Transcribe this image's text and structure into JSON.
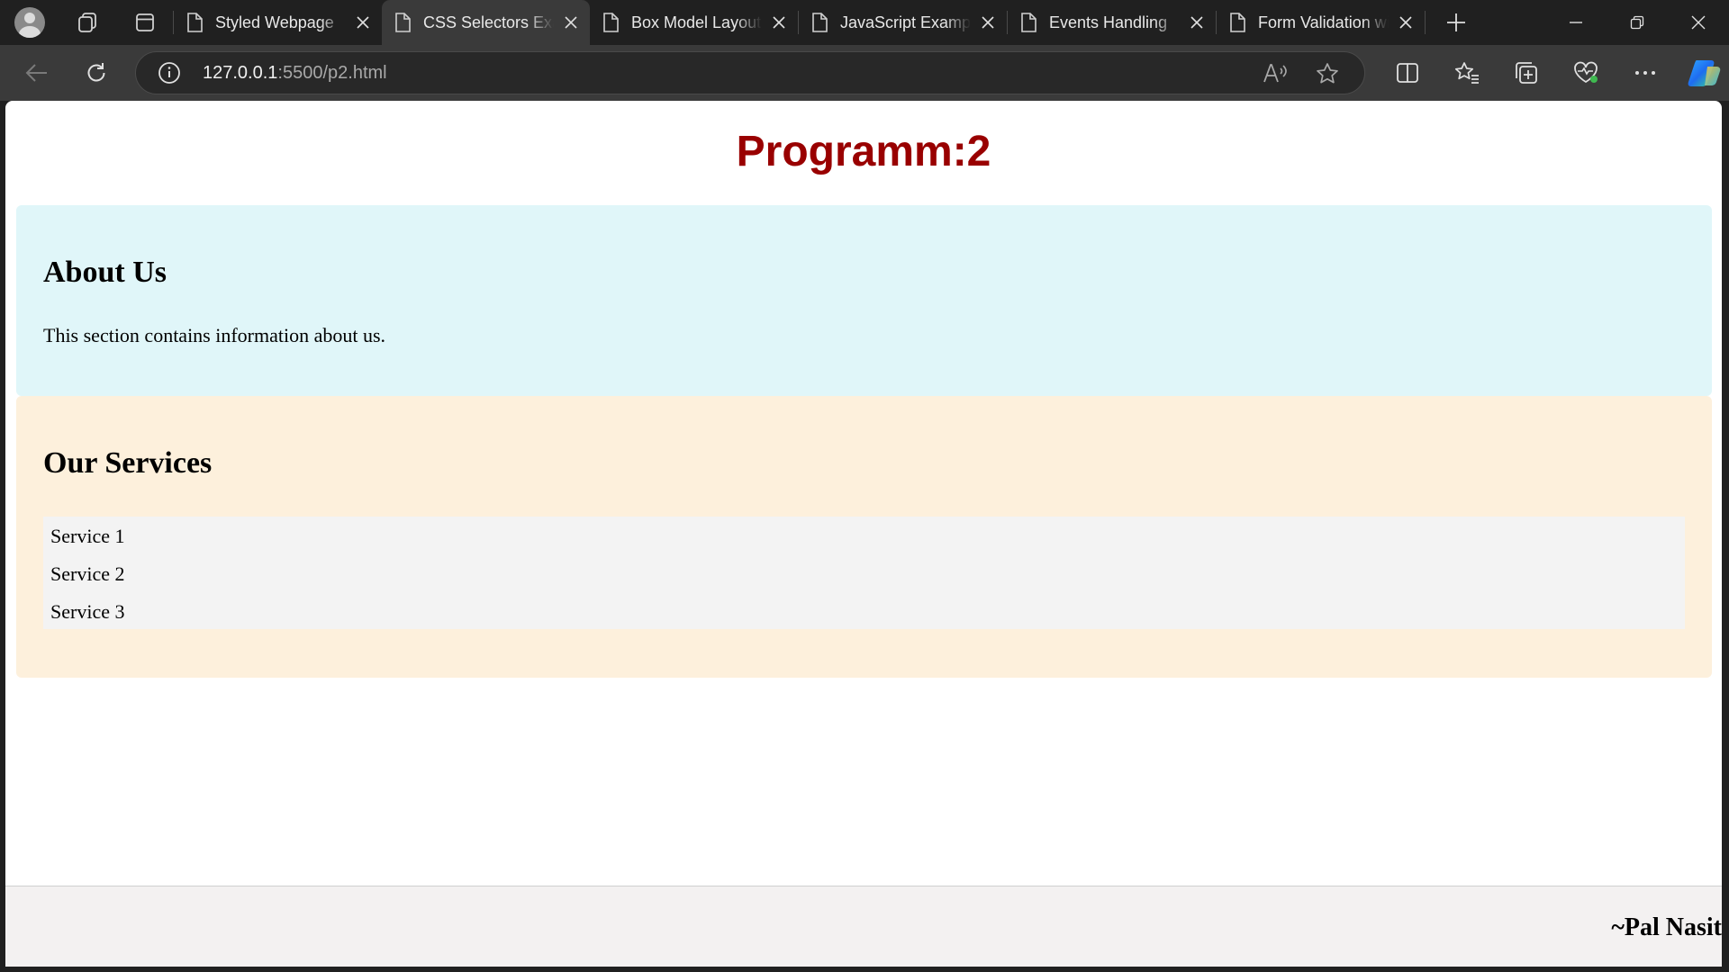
{
  "browser": {
    "tabs": [
      {
        "title": "Styled Webpage",
        "active": false
      },
      {
        "title": "CSS Selectors Example",
        "active": true
      },
      {
        "title": "Box Model Layout",
        "active": false
      },
      {
        "title": "JavaScript Example",
        "active": false
      },
      {
        "title": "Events Handling",
        "active": false
      },
      {
        "title": "Form Validation with JavaScript",
        "active": false
      }
    ],
    "address": {
      "host": "127.0.0.1",
      "rest": ":5500/p2.html"
    },
    "icons": {
      "profile": "avatar-icon",
      "workspaces": "workspaces-icon",
      "tab_actions": "tab-actions-icon",
      "page": "page-icon",
      "close": "close-icon",
      "new_tab": "plus-icon",
      "minimize": "minimize-icon",
      "restore": "restore-icon",
      "window_close": "close-icon",
      "back": "back-arrow-icon",
      "refresh": "refresh-icon",
      "site_info": "info-icon",
      "read_aloud": "read-aloud-icon",
      "favorite": "star-icon",
      "split_screen": "split-screen-icon",
      "favorites": "favorites-icon",
      "collections": "collections-icon",
      "browser_essentials": "heartbeat-icon",
      "more": "more-icon",
      "copilot": "copilot-icon"
    }
  },
  "page": {
    "title": "Programm:2",
    "about": {
      "heading": "About Us",
      "text": "This section contains information about us."
    },
    "services": {
      "heading": "Our Services",
      "items": [
        "Service 1",
        "Service 2",
        "Service 3"
      ]
    },
    "footer": {
      "signature": "~Pal Nasit"
    }
  },
  "colors": {
    "title": "#990000",
    "about_bg": "#e0f6f9",
    "services_bg": "#fdf0dc",
    "list_bg": "#f3f3f3",
    "footer_bg": "#f3f1f1"
  }
}
